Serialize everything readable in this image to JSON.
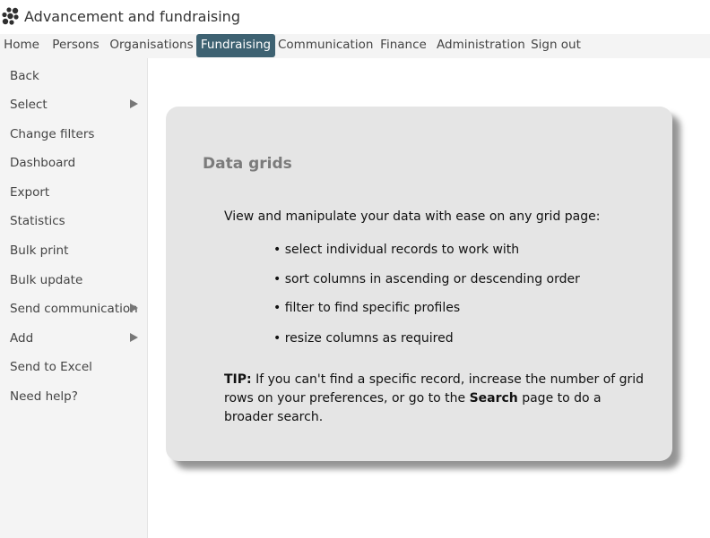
{
  "app": {
    "title": "Advancement and fundraising",
    "logo_icon": "hexagon-cluster-icon"
  },
  "nav": {
    "items": [
      {
        "label": "Home"
      },
      {
        "label": "Persons"
      },
      {
        "label": "Organisations"
      },
      {
        "label": "Fundraising",
        "active": true
      },
      {
        "label": "Communication"
      },
      {
        "label": "Finance"
      },
      {
        "label": "Administration"
      },
      {
        "label": "Sign out"
      }
    ],
    "active_color": "#3e6272"
  },
  "sidebar": {
    "items": [
      {
        "label": "Back"
      },
      {
        "label": "Select",
        "submenu": true
      },
      {
        "label": "Change filters"
      },
      {
        "label": "Dashboard"
      },
      {
        "label": "Export"
      },
      {
        "label": "Statistics"
      },
      {
        "label": "Bulk print"
      },
      {
        "label": "Bulk update"
      },
      {
        "label": "Send communication",
        "submenu": true
      },
      {
        "label": "Add",
        "submenu": true
      },
      {
        "label": "Send to Excel"
      },
      {
        "label": "Need help?"
      }
    ]
  },
  "card": {
    "title": "Data grids",
    "intro": "View and manipulate your data with ease on any grid page:",
    "bullets": [
      "• select individual records to work with",
      "• sort columns in ascending or descending order",
      "• filter to find specific profiles",
      "• resize columns as required"
    ],
    "tip": {
      "prefix": "TIP:",
      "text1": " If you can't find a specific record, increase the number of grid rows on your preferences, or go to the ",
      "link": "Search",
      "text2": " page to do a broader search."
    }
  }
}
